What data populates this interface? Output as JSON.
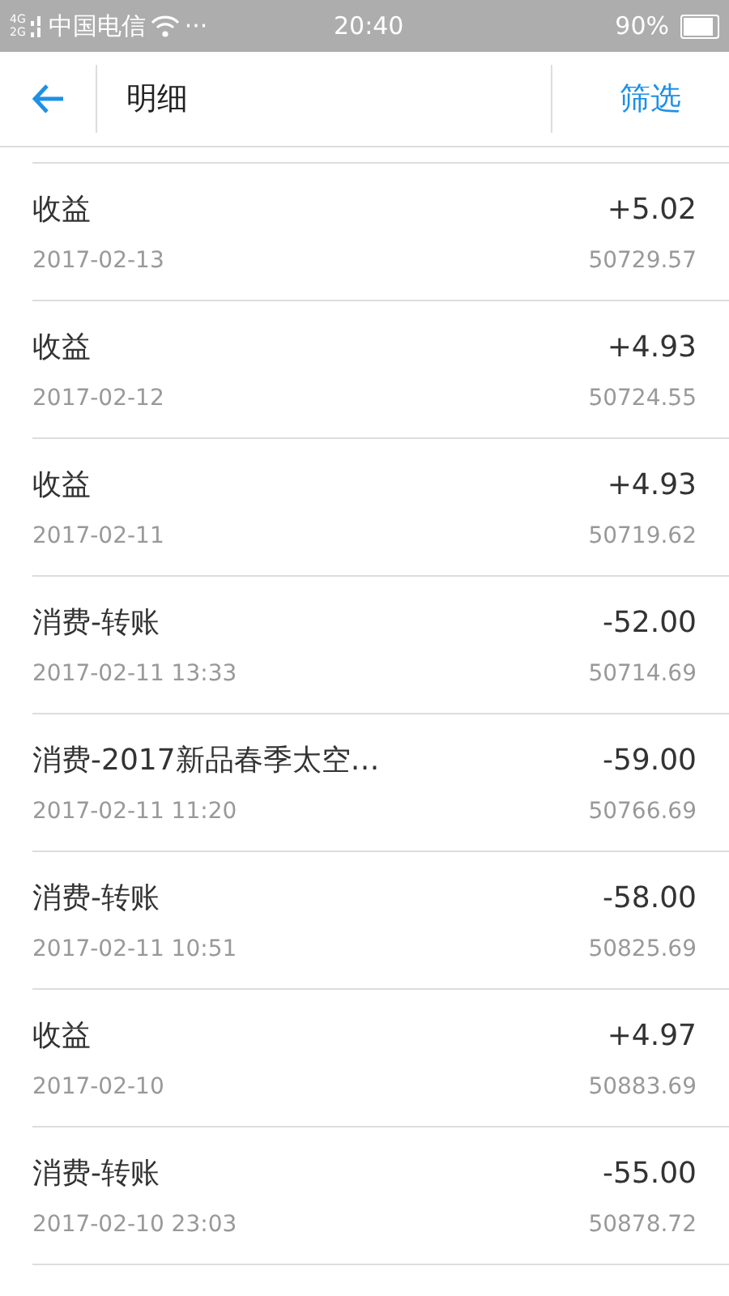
{
  "status_bar": {
    "network_top": "4G",
    "network_bottom": "2G",
    "carrier": "中国电信",
    "more": "···",
    "time": "20:40",
    "battery": "90%"
  },
  "header": {
    "title": "明细",
    "action": "筛选"
  },
  "records": [
    {
      "title": "收益",
      "date": "2017-02-13",
      "amount": "+5.02",
      "balance": "50729.57"
    },
    {
      "title": "收益",
      "date": "2017-02-12",
      "amount": "+4.93",
      "balance": "50724.55"
    },
    {
      "title": "收益",
      "date": "2017-02-11",
      "amount": "+4.93",
      "balance": "50719.62"
    },
    {
      "title": "消费-转账",
      "date": "2017-02-11 13:33",
      "amount": "-52.00",
      "balance": "50714.69"
    },
    {
      "title": "消费-2017新品春季太空…",
      "date": "2017-02-11 11:20",
      "amount": "-59.00",
      "balance": "50766.69"
    },
    {
      "title": "消费-转账",
      "date": "2017-02-11 10:51",
      "amount": "-58.00",
      "balance": "50825.69"
    },
    {
      "title": "收益",
      "date": "2017-02-10",
      "amount": "+4.97",
      "balance": "50883.69"
    },
    {
      "title": "消费-转账",
      "date": "2017-02-10 23:03",
      "amount": "-55.00",
      "balance": "50878.72"
    }
  ]
}
